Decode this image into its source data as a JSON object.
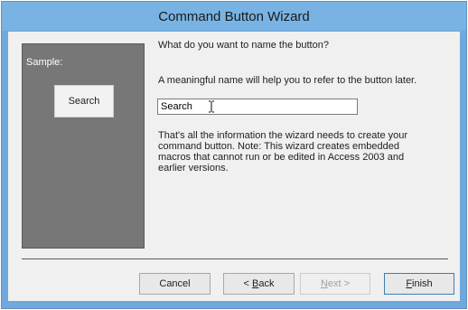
{
  "window": {
    "title": "Command Button Wizard"
  },
  "sample": {
    "label": "Sample:",
    "button_label": "Search"
  },
  "prompt": {
    "question": "What do you want to name the button?",
    "hint": "A meaningful name will help you to refer to the button later.",
    "name_value": "Search",
    "info": "That's all the information the wizard needs to create your command button. Note: This wizard creates embedded macros that cannot run or be edited in Access 2003 and earlier versions."
  },
  "buttons": {
    "cancel": "Cancel",
    "back_prefix": "< ",
    "back_mnemonic": "B",
    "back_rest": "ack",
    "next_mnemonic": "N",
    "next_rest": "ext >",
    "finish_mnemonic": "F",
    "finish_rest": "inish"
  },
  "colors": {
    "title_bar": "#79b3e3",
    "sample_panel": "#777777"
  }
}
